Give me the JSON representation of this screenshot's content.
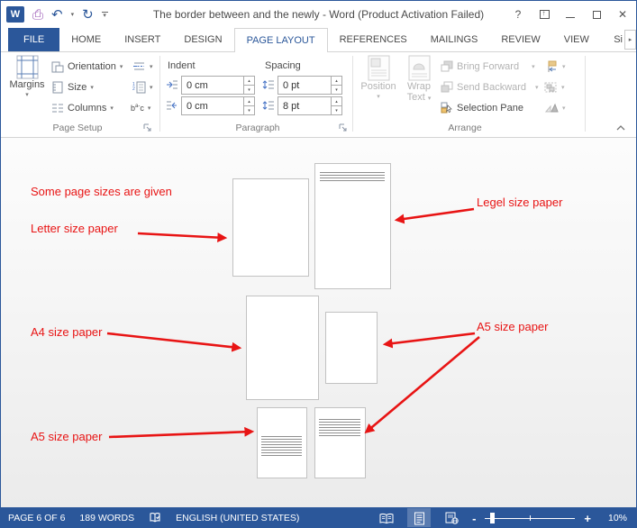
{
  "window": {
    "title": "The border between and the newly - Word (Product Activation Failed)",
    "logo": "W"
  },
  "tabs": {
    "file": "FILE",
    "items": [
      "HOME",
      "INSERT",
      "DESIGN",
      "PAGE LAYOUT",
      "REFERENCES",
      "MAILINGS",
      "REVIEW",
      "VIEW"
    ],
    "active": "PAGE LAYOUT",
    "overflow": "Si"
  },
  "ribbon": {
    "page_setup": {
      "label": "Page Setup",
      "margins": "Margins",
      "orientation": "Orientation",
      "size": "Size",
      "columns": "Columns"
    },
    "paragraph": {
      "label": "Paragraph",
      "indent": "Indent",
      "spacing": "Spacing",
      "indent_left": "0 cm",
      "indent_right": "0 cm",
      "spacing_before": "0 pt",
      "spacing_after": "8 pt"
    },
    "arrange": {
      "label": "Arrange",
      "position": "Position",
      "wrap_line1": "Wrap",
      "wrap_line2": "Text",
      "bring_forward": "Bring Forward",
      "send_backward": "Send Backward",
      "selection_pane": "Selection Pane"
    }
  },
  "doc": {
    "notes": {
      "intro": "Some page sizes are given",
      "letter": "Letter size paper",
      "legal": "Legel size paper",
      "a4": "A4 size paper",
      "a5_right": "A5 size paper",
      "a5_bottom": "A5 size paper"
    }
  },
  "status": {
    "page": "PAGE 6 OF 6",
    "words": "189 WORDS",
    "language": "ENGLISH (UNITED STATES)",
    "zoom_minus": "-",
    "zoom_plus": "+",
    "zoom_level": "10%"
  },
  "icons": {
    "dropdown": "▾",
    "undo": "↶",
    "redo": "↻",
    "spin_up": "▴",
    "spin_down": "▾",
    "overflow_arrow": "▸",
    "help": "?",
    "close": "✕"
  },
  "colors": {
    "accent_blue": "#2b579a",
    "annotation_red": "#e81414",
    "disabled_gray": "#b3b3b3"
  }
}
